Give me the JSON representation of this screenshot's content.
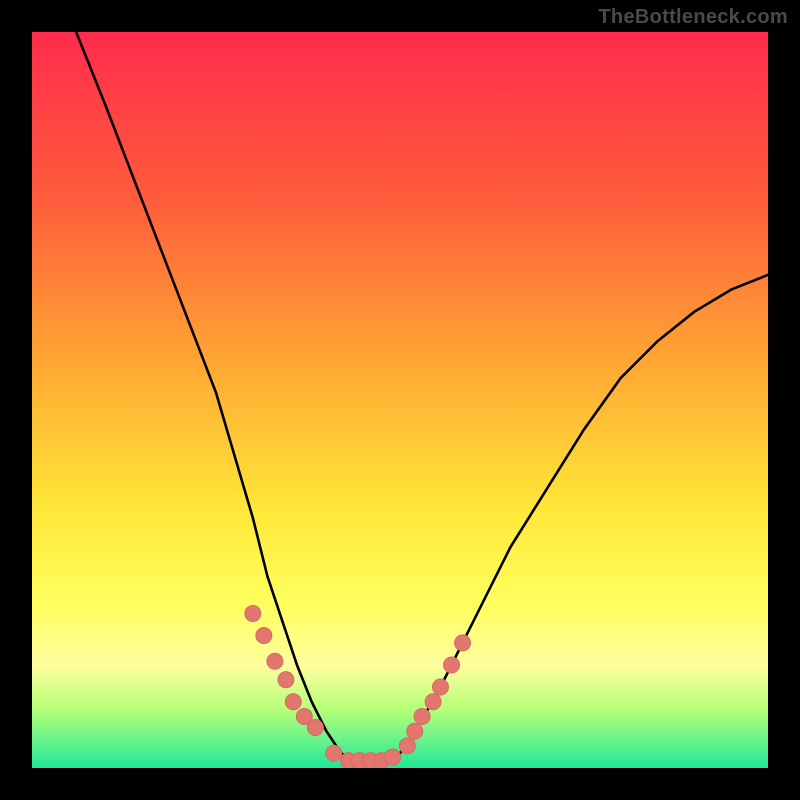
{
  "attribution": "TheBottleneck.com",
  "colors": {
    "background": "#000000",
    "gradient_top": "#ff2c4d",
    "gradient_bottom": "#20e898",
    "curve": "#000000",
    "marker_fill": "#e2776f",
    "marker_stroke": "#d86a63"
  },
  "chart_data": {
    "type": "line",
    "title": "",
    "xlabel": "",
    "ylabel": "",
    "xlim": [
      0,
      100
    ],
    "ylim": [
      0,
      100
    ],
    "series": [
      {
        "name": "bottleneck-curve",
        "x": [
          6,
          10,
          15,
          20,
          25,
          30,
          32,
          34,
          36,
          38,
          40,
          42,
          44,
          46,
          48,
          50,
          52,
          55,
          60,
          65,
          70,
          75,
          80,
          85,
          90,
          95,
          100
        ],
        "y": [
          100,
          90,
          77,
          64,
          51,
          34,
          26,
          20,
          14,
          9,
          5,
          2,
          1,
          1,
          1,
          2,
          5,
          10,
          20,
          30,
          38,
          46,
          53,
          58,
          62,
          65,
          67
        ]
      }
    ],
    "markers": {
      "name": "highlighted-points",
      "x": [
        30,
        31.5,
        33,
        34.5,
        35.5,
        37,
        38.5,
        41,
        43,
        44.5,
        46,
        47.5,
        49,
        51,
        52,
        53,
        54.5,
        55.5,
        57,
        58.5
      ],
      "y": [
        21,
        18,
        14.5,
        12,
        9,
        7,
        5.5,
        2,
        1,
        1,
        1,
        1,
        1.5,
        3,
        5,
        7,
        9,
        11,
        14,
        17
      ]
    }
  }
}
